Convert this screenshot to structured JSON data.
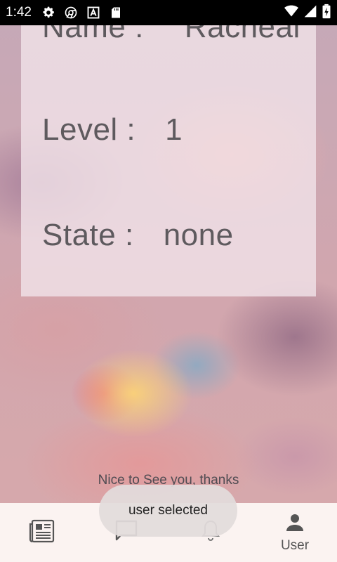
{
  "status_bar": {
    "time": "1:42",
    "left_icons": [
      "settings-icon",
      "chrome-icon",
      "font-icon",
      "sd-card-icon"
    ],
    "right_icons": [
      "wifi-icon",
      "signal-icon",
      "battery-charging-icon"
    ]
  },
  "profile": {
    "name_label": "Name :",
    "name_value": "Racheal",
    "level_label": "Level :",
    "level_value": "1",
    "state_label": "State :",
    "state_value": "none"
  },
  "footer_text": "Nice to See you, thanks",
  "toast": "user selected",
  "bottom_nav": {
    "items": [
      {
        "icon": "news-icon",
        "label": ""
      },
      {
        "icon": "chat-icon",
        "label": ""
      },
      {
        "icon": "bell-icon",
        "label": ""
      },
      {
        "icon": "user-icon",
        "label": "User"
      }
    ],
    "selected_index": 3
  },
  "colors": {
    "status_bar_bg": "#000000",
    "card_bg": "#f0e2e8",
    "text": "#5e5a5e",
    "nav_bg": "#fbf3f1",
    "toast_bg": "#e2dbdb"
  }
}
